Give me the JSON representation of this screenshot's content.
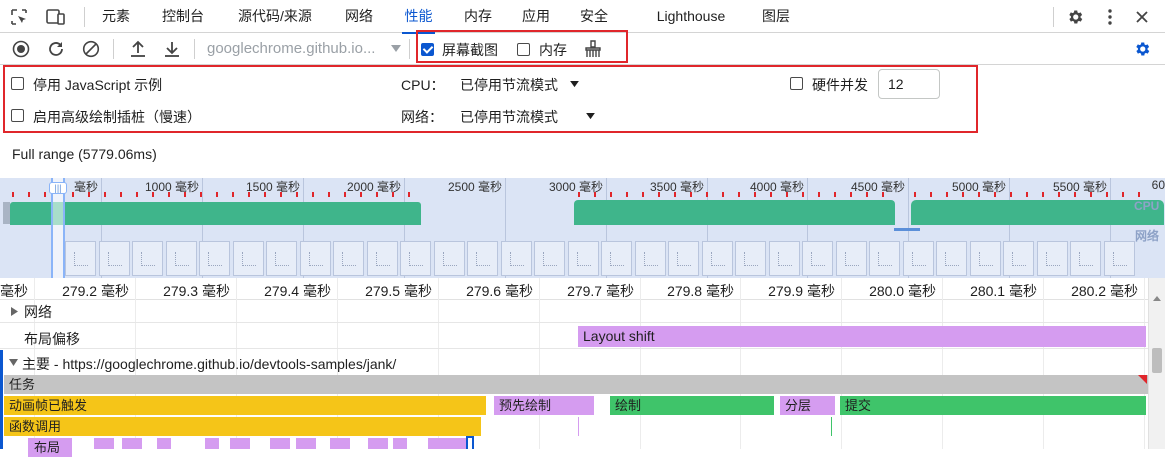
{
  "tabs": {
    "elements": "元素",
    "console": "控制台",
    "sources": "源代码/来源",
    "network": "网络",
    "performance": "性能",
    "memory": "内存",
    "application": "应用",
    "security": "安全",
    "lighthouse": "Lighthouse",
    "layers": "图层"
  },
  "toolbar": {
    "url": "googlechrome.github.io...",
    "screenshots_label": "屏幕截图",
    "screenshots_checked": true,
    "memory_label": "内存",
    "memory_checked": false
  },
  "settings": {
    "disable_js_samples": "停用 JavaScript 示例",
    "enable_paint_instrumentation": "启用高级绘制插桩（慢速）",
    "cpu_label": "CPU：",
    "cpu_value": "已停用节流模式",
    "network_label": "网络：",
    "network_value": "已停用节流模式",
    "hardware_concurrency_label": "硬件并发",
    "hardware_concurrency_value": "12"
  },
  "full_range": "Full range (5779.06ms)",
  "overview": {
    "tick_labels": [
      "毫秒",
      "1000 毫秒",
      "1500 毫秒",
      "2000 毫秒",
      "2500 毫秒",
      "3000 毫秒",
      "3500 毫秒",
      "4000 毫秒",
      "4500 毫秒",
      "5000 毫秒",
      "5500 毫秒",
      "60"
    ],
    "cpu_label": "CPU",
    "network_label": "网络"
  },
  "ruler": {
    "labels": [
      "毫秒",
      "279.2 毫秒",
      "279.3 毫秒",
      "279.4 毫秒",
      "279.5 毫秒",
      "279.6 毫秒",
      "279.7 毫秒",
      "279.8 毫秒",
      "279.9 毫秒",
      "280.0 毫秒",
      "280.1 毫秒",
      "280.2 毫秒"
    ]
  },
  "tracks": {
    "network": "网络",
    "layout_shifts": "布局偏移",
    "layout_shift_bar": "Layout shift",
    "main": "主要 - https://googlechrome.github.io/devtools-samples/jank/"
  },
  "flame": {
    "task": "任务",
    "animation_frame_fired": "动画帧已触发",
    "pre_paint": "预先绘制",
    "paint": "绘制",
    "layerize": "分层",
    "commit": "提交",
    "function_call": "函数调用",
    "layout": "布局"
  },
  "colors": {
    "accent": "#0b57d0",
    "cpu_green": "#3fb58b",
    "task_grey": "#c4c4c4",
    "scripting_yellow": "#f5c518",
    "rendering_purple": "#d59cf0",
    "painting_green": "#3fc46a",
    "highlight_red": "#e0262b"
  }
}
